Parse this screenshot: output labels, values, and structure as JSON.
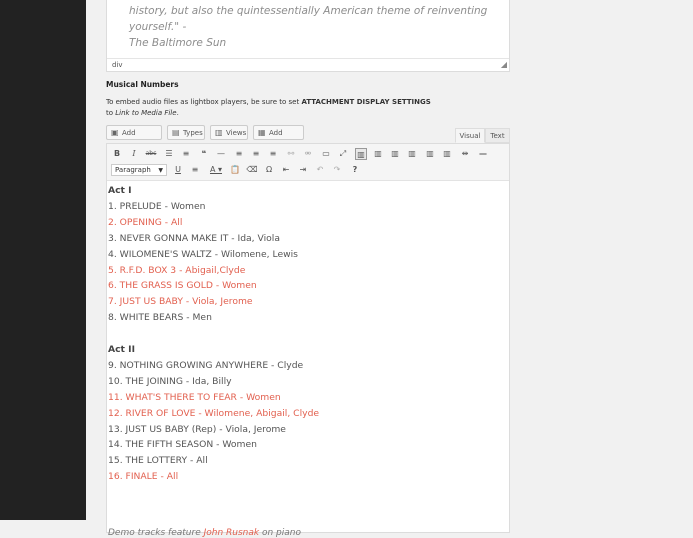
{
  "previous_field": {
    "quote_line1": "history, but also the quintessentially American theme of reinventing yourself.\" -",
    "quote_line2": "The Baltimore Sun",
    "path": "div"
  },
  "section": {
    "label": "Musical Numbers",
    "desc_prefix": "To embed audio files as lightbox players, be sure to set ",
    "desc_bold": "ATTACHMENT DISPLAY SETTINGS",
    "desc_line2_prefix": "to ",
    "desc_italic": "Link to Media File",
    "desc_period": "."
  },
  "media_buttons": [
    {
      "label": "Add Media",
      "icon": "media-icon"
    },
    {
      "label": "Types",
      "icon": "types-icon"
    },
    {
      "label": "Views",
      "icon": "views-icon"
    },
    {
      "label": "Add Form",
      "icon": "form-icon"
    }
  ],
  "tabs": {
    "visual": "Visual",
    "text": "Text"
  },
  "toolbar": {
    "format_select": "Paragraph"
  },
  "content_lines": [
    {
      "text": "Act I",
      "style": "head"
    },
    {
      "text": "1. PRELUDE - Women",
      "style": "normal"
    },
    {
      "text": "2. OPENING - All",
      "style": "red"
    },
    {
      "text": "3. NEVER GONNA MAKE IT - Ida, Viola",
      "style": "normal"
    },
    {
      "text": "4. WILOMENE'S WALTZ - Wilomene, Lewis",
      "style": "normal"
    },
    {
      "text": "5. R.F.D. BOX 3 - Abigail,Clyde",
      "style": "red"
    },
    {
      "text": "6. THE GRASS IS GOLD - Women",
      "style": "red"
    },
    {
      "text": "7. JUST US BABY - Viola, Jerome",
      "style": "red"
    },
    {
      "text": "8. WHITE BEARS - Men",
      "style": "normal"
    },
    {
      "text": "",
      "style": "blank"
    },
    {
      "text": "Act II",
      "style": "head"
    },
    {
      "text": "9. NOTHING GROWING ANYWHERE - Clyde",
      "style": "normal"
    },
    {
      "text": "10. THE JOINING - Ida, Billy",
      "style": "normal"
    },
    {
      "text": "11. WHAT'S THERE TO FEAR - Women",
      "style": "red"
    },
    {
      "text": "12. RIVER OF LOVE - Wilomene, Abigail, Clyde",
      "style": "red"
    },
    {
      "text": "13. JUST US BABY (Rep) - Viola, Jerome",
      "style": "normal"
    },
    {
      "text": "14. THE FIFTH SEASON - Women",
      "style": "normal"
    },
    {
      "text": "15. THE LOTTERY - All",
      "style": "normal"
    },
    {
      "text": "16. FINALE - All",
      "style": "red"
    }
  ],
  "footer": {
    "prefix": "Demo tracks feature ",
    "link": "John Rusnak",
    "suffix": " on piano"
  }
}
